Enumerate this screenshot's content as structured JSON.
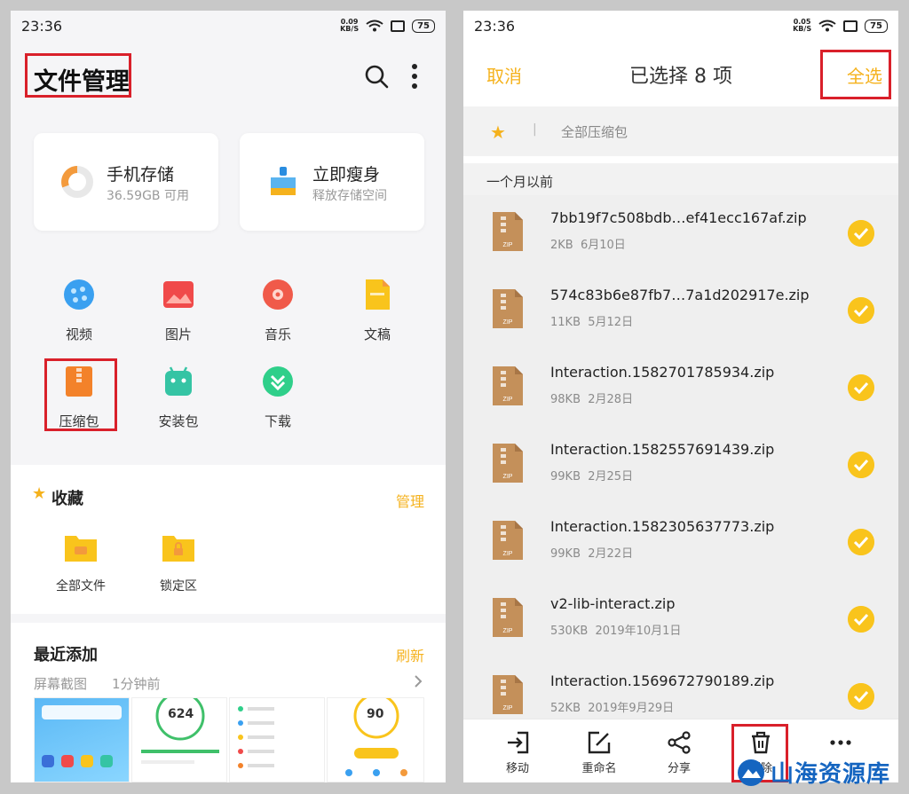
{
  "left": {
    "status": {
      "time": "23:36",
      "net_speed": "0.09",
      "net_unit": "KB/S",
      "battery": "75"
    },
    "title": "文件管理",
    "storage_cards": [
      {
        "title": "手机存储",
        "subtitle": "36.59GB 可用"
      },
      {
        "title": "立即瘦身",
        "subtitle": "释放存储空间"
      }
    ],
    "categories": [
      "视频",
      "图片",
      "音乐",
      "文稿",
      "压缩包",
      "安装包",
      "下载"
    ],
    "favorites": {
      "title": "收藏",
      "action": "管理",
      "items": [
        "全部文件",
        "锁定区"
      ]
    },
    "recent": {
      "title": "最近添加",
      "action": "刷新",
      "source": "屏幕截图",
      "time": "1分钟前",
      "thumb_values": [
        "624",
        "90"
      ]
    }
  },
  "right": {
    "status": {
      "time": "23:36",
      "net_speed": "0.05",
      "net_unit": "KB/S",
      "battery": "75"
    },
    "header": {
      "cancel": "取消",
      "title": "已选择 8 项",
      "select_all": "全选"
    },
    "path": "全部压缩包",
    "group": "一个月以前",
    "files": [
      {
        "name": "7bb19f7c508bdb…ef41ecc167af.zip",
        "size": "2KB",
        "date": "6月10日"
      },
      {
        "name": "574c83b6e87fb7…7a1d202917e.zip",
        "size": "11KB",
        "date": "5月12日"
      },
      {
        "name": "Interaction.1582701785934.zip",
        "size": "98KB",
        "date": "2月28日"
      },
      {
        "name": "Interaction.1582557691439.zip",
        "size": "99KB",
        "date": "2月25日"
      },
      {
        "name": "Interaction.1582305637773.zip",
        "size": "99KB",
        "date": "2月22日"
      },
      {
        "name": "v2-lib-interact.zip",
        "size": "530KB",
        "date": "2019年10月1日"
      },
      {
        "name": "Interaction.1569672790189.zip",
        "size": "52KB",
        "date": "2019年9月29日"
      }
    ],
    "zip_label": "ZIP",
    "toolbar": [
      "移动",
      "重命名",
      "分享",
      "删除"
    ]
  },
  "watermark": "山海资源库",
  "colors": {
    "accent": "#f5b21d",
    "check": "#f9c41c",
    "highlight": "#d9202a",
    "zip": "#c4905a"
  }
}
